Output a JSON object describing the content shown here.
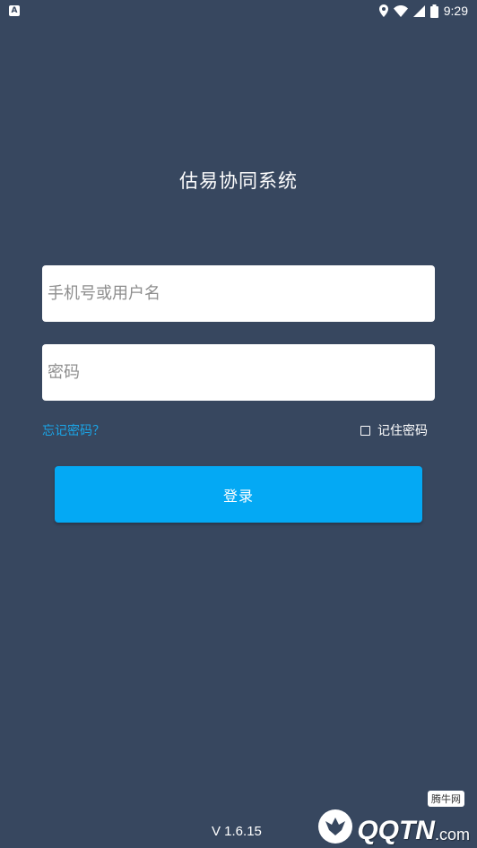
{
  "status_bar": {
    "notification_icon": "A",
    "time": "9:29"
  },
  "app": {
    "title": "估易协同系统"
  },
  "form": {
    "username_placeholder": "手机号或用户名",
    "username_value": "",
    "password_placeholder": "密码",
    "password_value": "",
    "forgot_label": "忘记密码？",
    "remember_label": "记住密码",
    "remember_checked": false,
    "login_label": "登录"
  },
  "footer": {
    "version": "V 1.6.15"
  },
  "watermark": {
    "brand_main": "QQTN",
    "brand_suffix": ".com",
    "brand_cn": "腾牛网"
  },
  "colors": {
    "background": "#37475f",
    "accent": "#04a9f4",
    "link": "#1aa6e8"
  }
}
